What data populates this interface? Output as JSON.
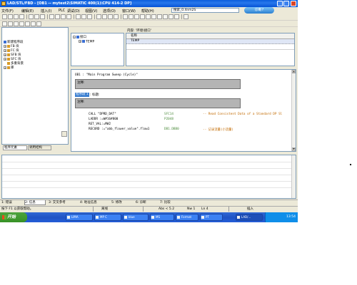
{
  "window": {
    "title": "LAD/STL/FBD - [OB1 -- mytest2\\SIMATIC 400(1)\\CPU 414-2 DP]"
  },
  "menu": {
    "items": [
      "文件(F)",
      "编辑(E)",
      "插入(I)",
      "PLC",
      "调试(D)",
      "视图(V)",
      "选项(O)",
      "窗口(W)",
      "帮助(H)"
    ]
  },
  "search": {
    "value": "搜索_0.4nm2S"
  },
  "help_button": "诊断?",
  "left_tree": {
    "items": [
      "新建程序段",
      "FB 块",
      "FC 块",
      "SFB 块",
      "SFC 块",
      "多重背景",
      "库"
    ]
  },
  "left_tabs": [
    "程序元素",
    "调用结构"
  ],
  "interface": {
    "header": "内容: '环境\\接口'",
    "tree_root": "接口",
    "tree_child": "TEMP",
    "column_name": "名称",
    "row": "TEMP"
  },
  "code": {
    "ob_title": "OB1 :  \"Main Program Sweep (Cycle)\"",
    "comment1": "注释:",
    "network_label": "程序段 1",
    "network_title": ": 标题:",
    "comment2": "注释:",
    "lines": [
      {
        "instr": "CALL  \"DPRD_DAT\"",
        "sym": "SFC14",
        "cmt": "-- Read Consistent Data of a Standard DP Sl"
      },
      {
        "instr": "  LADDR  :=W#16#800",
        "sym": "P2048",
        "cmt": ""
      },
      {
        "instr": "  RET_VAL:=MW2",
        "sym": "",
        "cmt": ""
      },
      {
        "instr": "  RECORD :=\"abb_flower_value\".flow1",
        "sym": "DB1.DBB0",
        "cmt": "-- 记录流量(小流量)"
      }
    ]
  },
  "bottom_tabs": [
    "1: 错误",
    "2: 信息",
    "3: 交叉参考",
    "4: 地址信息",
    "5: 修改",
    "6: 诊断",
    "7: 比较"
  ],
  "status": {
    "help": "按下 F1 以获取帮助。",
    "connection": "离线",
    "abs": "Abs < 5.2",
    "nw": "Nw 1",
    "line": "Ln 4",
    "mode": "插入"
  },
  "taskbar": {
    "start": "开始",
    "tasks": [
      "LIMA",
      "MP C",
      "blue",
      "MS",
      "Format",
      "PT",
      "LAD/..."
    ],
    "clock": "13:54"
  },
  "colors": {
    "title_blue": "#0a5ddc",
    "network_blue": "#3b7fd1",
    "comment_gray": "#b4b4b4",
    "symbol_green": "#4a8a3a",
    "comment_orange": "#c26a00",
    "taskbar_blue": "#245dd8",
    "start_green": "#389226"
  }
}
